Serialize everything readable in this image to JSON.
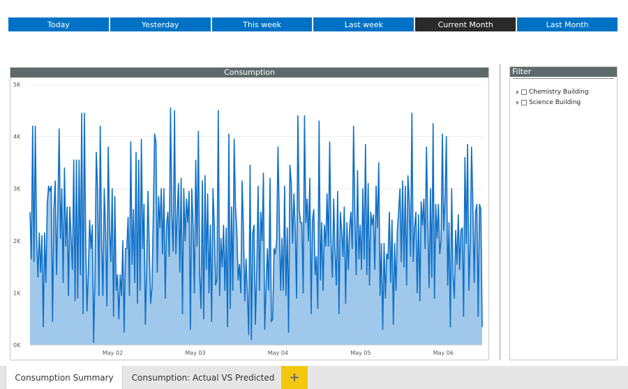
{
  "date_range": {
    "buttons": [
      {
        "label": "Today",
        "active": false
      },
      {
        "label": "Yesterday",
        "active": false
      },
      {
        "label": "This week",
        "active": false
      },
      {
        "label": "Last week",
        "active": false
      },
      {
        "label": "Current Month",
        "active": true
      },
      {
        "label": "Last Month",
        "active": false
      }
    ],
    "colors": {
      "button": "#0072c6",
      "active": "#2a2a2a"
    }
  },
  "chart": {
    "title": "Consumption"
  },
  "chart_data": {
    "type": "area",
    "title": "Consumption",
    "ylim": [
      0,
      5000
    ],
    "y_ticks": [
      "0K",
      "1K",
      "2K",
      "3K",
      "4K",
      "5K"
    ],
    "x_ticks": [
      "May 02",
      "May 03",
      "May 04",
      "May 05",
      "May 06"
    ],
    "x_range_days": [
      1.0,
      6.47
    ],
    "grid": true,
    "colors": {
      "line": "#0f6fc6",
      "fill": "#a0c8ea"
    },
    "series": [
      {
        "values": [
          2550,
          1650,
          4200,
          1600,
          4200,
          2050,
          1300,
          2150,
          1400,
          2100,
          350,
          2150,
          1200,
          2700,
          3050,
          2950,
          3050,
          450,
          2600,
          3150,
          1350,
          2650,
          4150,
          2050,
          3000,
          1200,
          3400,
          1900,
          2650,
          950,
          2650,
          2050,
          1450,
          3550,
          850,
          3550,
          900,
          3550,
          1350,
          4450,
          600,
          4450,
          2050,
          650,
          1400,
          2400,
          1850,
          2300,
          50,
          1350,
          3700,
          2950,
          950,
          4200,
          2000,
          950,
          3000,
          2150,
          750,
          3800,
          2250,
          1600,
          3000,
          550,
          2850,
          1050,
          1350,
          500,
          1350,
          950,
          2000,
          250,
          1850,
          1850,
          2450,
          950,
          3900,
          1550,
          2600,
          1200,
          3700,
          800,
          3550,
          1050,
          3950,
          1850,
          2700,
          400,
          1500,
          2950,
          1800,
          800,
          1100,
          2500,
          4050,
          3900,
          1400,
          2850,
          2250,
          3000,
          1750,
          3000,
          900,
          2300,
          2550,
          1700,
          4550,
          2500,
          1800,
          4500,
          1750,
          2500,
          3100,
          1400,
          3200,
          600,
          3000,
          2000,
          2800,
          2350,
          2950,
          300,
          3000,
          2300,
          1000,
          3550,
          1900,
          4100,
          1350,
          700,
          3150,
          500,
          3250,
          1450,
          2900,
          1000,
          2300,
          450,
          3000,
          2300,
          1150,
          1250,
          4500,
          950,
          2050,
          1500,
          2300,
          1050,
          2250,
          350,
          4050,
          700,
          2650,
          1050,
          3950,
          2650,
          2200,
          1250,
          1550,
          1000,
          3150,
          2200,
          850,
          1650,
          950,
          200,
          3450,
          100,
          2150,
          2300,
          400,
          1450,
          3050,
          1050,
          2550,
          2000,
          3300,
          300,
          1100,
          1850,
          1050,
          3200,
          450,
          500,
          1850,
          1750,
          2000,
          3800,
          2400,
          1050,
          2050,
          1050,
          3050,
          950,
          2250,
          250,
          3450,
          3100,
          1950,
          2900,
          2250,
          900,
          4400,
          2600,
          2350,
          2350,
          1000,
          4400,
          2350,
          2800,
          2000,
          3200,
          600,
          2400,
          2600,
          1350,
          1700,
          700,
          4300,
          1250,
          2350,
          1050,
          2300,
          1900,
          2900,
          1900,
          3900,
          1950,
          1300,
          2800,
          1800,
          1150,
          2950,
          600,
          2550,
          2200,
          1700,
          2650,
          800,
          2350,
          1450,
          2250,
          2550,
          1850,
          4200,
          2450,
          1350,
          3350,
          1650,
          2300,
          1450,
          3000,
          1650,
          3850,
          1350,
          3100,
          1150,
          2550,
          2300,
          2500,
          1450,
          3050,
          2250,
          3500,
          950,
          1950,
          300,
          1950,
          900,
          1750,
          1650,
          2550,
          1200,
          2400,
          400,
          1950,
          1050,
          2200,
          2550,
          3000,
          1600,
          3150,
          1500,
          3050,
          1150,
          3250,
          2750,
          1700,
          4450,
          1600,
          2250,
          2550,
          1000,
          2500,
          850,
          2750,
          2300,
          2800,
          1850,
          3800,
          2350,
          1100,
          3000,
          1300,
          4250,
          900,
          2700,
          2050,
          2700,
          1750,
          2000,
          4050,
          2200,
          2800,
          4000,
          1150,
          2350,
          350,
          3000,
          1350,
          900,
          2200,
          1550,
          2500,
          1450,
          2200,
          2250,
          550,
          3600,
          1950,
          3850,
          1050,
          2000,
          3800,
          2700,
          1200,
          2550,
          2700,
          550,
          2700,
          2600,
          350
        ]
      }
    ]
  },
  "filter": {
    "title": "Filter",
    "items": [
      {
        "label": "Chemistry Building"
      },
      {
        "label": "Science Building"
      }
    ]
  },
  "tabs": {
    "items": [
      {
        "label": "Consumption Summary",
        "active": true
      },
      {
        "label": "Consumption: Actual VS Predicted",
        "active": false
      }
    ],
    "add_label": "+",
    "colors": {
      "add": "#f2c80f"
    }
  }
}
